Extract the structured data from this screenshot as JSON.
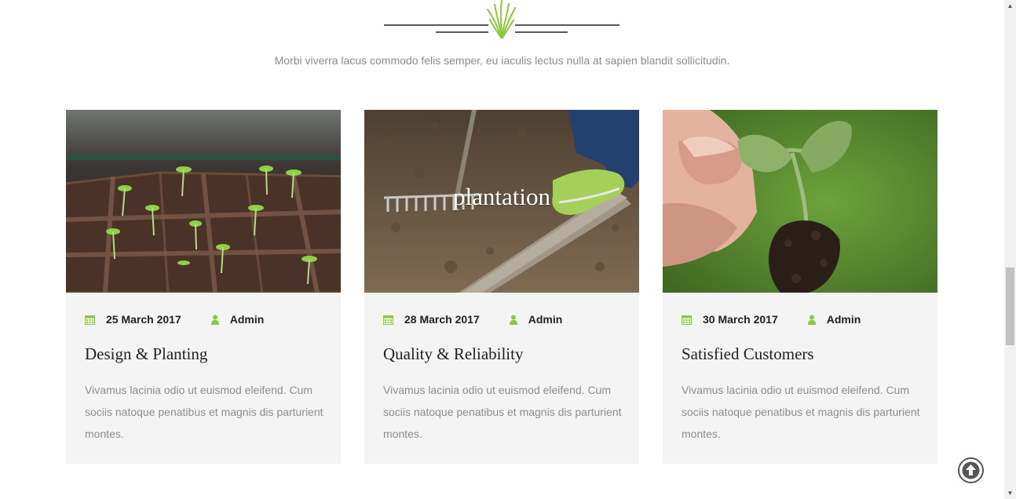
{
  "section": {
    "subtitle": "Morbi viverra lacus commodo felis semper, eu iaculis lectus nulla at sapien blandit sollicitudin."
  },
  "colors": {
    "accent": "#8dc63f",
    "card_bg": "#f4f4f4",
    "text_muted": "#8c8c8c",
    "title": "#222222"
  },
  "cards": [
    {
      "image": "seedlings-tray",
      "caption": "",
      "date": "25 March 2017",
      "author": "Admin",
      "title": "Design & Planting",
      "text": "Vivamus lacinia odio ut euismod eleifend. Cum sociis natoque penatibus et magnis dis parturient montes."
    },
    {
      "image": "rake-soil",
      "caption": "plantation",
      "date": "28 March 2017",
      "author": "Admin",
      "title": "Quality & Reliability",
      "text": "Vivamus lacinia odio ut euismod eleifend. Cum sociis natoque penatibus et magnis dis parturient montes."
    },
    {
      "image": "hand-seedling",
      "caption": "",
      "date": "30 March 2017",
      "author": "Admin",
      "title": "Satisfied Customers",
      "text": "Vivamus lacinia odio ut euismod eleifend. Cum sociis natoque penatibus et magnis dis parturient montes."
    }
  ],
  "icons": {
    "date": "calendar-icon",
    "author": "user-icon",
    "back_to_top": "arrow-up-circle-icon",
    "divider": "grass-icon"
  }
}
